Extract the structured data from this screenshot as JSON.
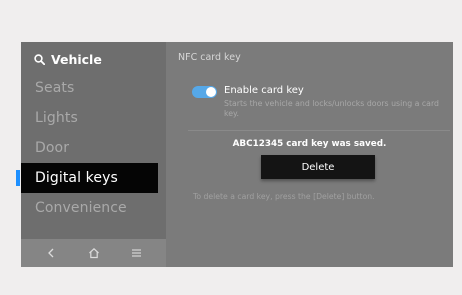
{
  "sidebar": {
    "title": "Vehicle",
    "items": [
      {
        "label": "Seats"
      },
      {
        "label": "Lights"
      },
      {
        "label": "Door"
      },
      {
        "label": "Digital keys"
      },
      {
        "label": "Convenience"
      }
    ],
    "active_item": "Digital keys"
  },
  "bottom_nav": {
    "back_icon": "chevron-left-icon",
    "home_icon": "home-icon",
    "menu_icon": "menu-icon"
  },
  "content": {
    "title": "NFC card key",
    "toggle": {
      "label": "Enable card key",
      "on": true,
      "description": "Starts the vehicle and locks/unlocks doors using a card key."
    },
    "saved_message": "ABC12345 card key was saved.",
    "delete_label": "Delete",
    "hint": "To delete a card key, press the [Delete] button."
  },
  "colors": {
    "accent": "#56a8e8",
    "active_marker": "#1e90ff",
    "active_bg": "#050505",
    "panel_bg": "#7b7b7b"
  }
}
